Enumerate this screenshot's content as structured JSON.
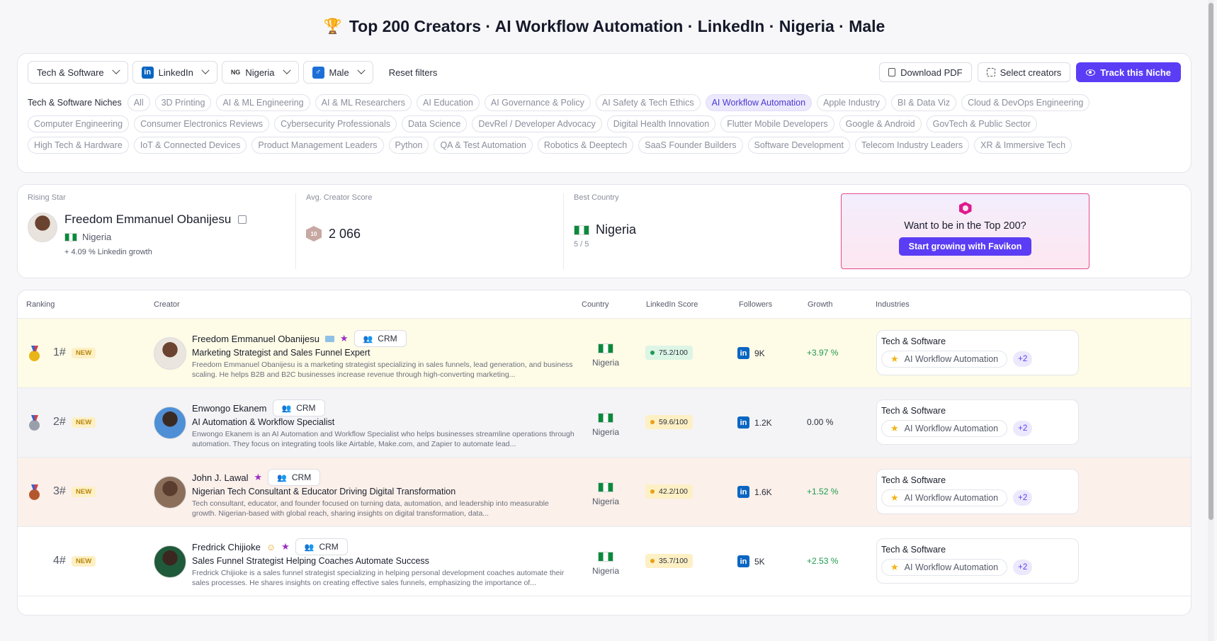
{
  "page_title": "Top 200 Creators · AI Workflow Automation · LinkedIn · Nigeria · Male",
  "filters": {
    "category": "Tech & Software",
    "platform": "LinkedIn",
    "country_code": "NG",
    "country": "Nigeria",
    "gender": "Male",
    "reset_label": "Reset filters",
    "download_label": "Download PDF",
    "select_label": "Select creators",
    "track_label": "Track this Niche",
    "niches_label": "Tech & Software Niches",
    "niche_rows": [
      [
        "All",
        "3D Printing",
        "AI & ML Engineering",
        "AI & ML Researchers",
        "AI Education",
        "AI Governance & Policy",
        "AI Safety & Tech Ethics",
        "AI Workflow Automation",
        "Apple Industry",
        "BI & Data Viz",
        "Cloud & DevOps Engineering"
      ],
      [
        "Computer Engineering",
        "Consumer Electronics Reviews",
        "Cybersecurity Professionals",
        "Data Science",
        "DevRel / Developer Advocacy",
        "Digital Health Innovation",
        "Flutter Mobile Developers",
        "Google & Android",
        "GovTech & Public Sector"
      ],
      [
        "High Tech & Hardware",
        "IoT & Connected Devices",
        "Product Management Leaders",
        "Python",
        "QA & Test Automation",
        "Robotics & Deeptech",
        "SaaS Founder Builders",
        "Software Development",
        "Telecom Industry Leaders",
        "XR & Immersive Tech"
      ]
    ],
    "active_niche": "AI Workflow Automation"
  },
  "stats": {
    "rising_star_label": "Rising Star",
    "rising_star_name": "Freedom Emmanuel Obanijesu",
    "rising_star_country": "Nigeria",
    "rising_star_growth": "+ 4.09 % Linkedin growth",
    "avg_label": "Avg. Creator Score",
    "avg_badge": "10",
    "avg_value": "2 066",
    "best_country_label": "Best Country",
    "best_country": "Nigeria",
    "best_country_sub": "5 / 5",
    "promo_text": "Want to be in the Top 200?",
    "promo_button": "Start growing with Favikon"
  },
  "table": {
    "headers": {
      "ranking": "Ranking",
      "creator": "Creator",
      "country": "Country",
      "score": "LinkedIn Score",
      "followers": "Followers",
      "growth": "Growth",
      "industries": "Industries"
    },
    "crm_label": "CRM",
    "new_label": "NEW",
    "li_letters": "in",
    "rows": [
      {
        "rank": "1#",
        "name": "Freedom Emmanuel Obanijesu",
        "title": "Marketing Strategist and Sales Funnel Expert",
        "desc": "Freedom Emmanuel Obanijesu is a marketing strategist specializing in sales funnels, lead generation, and business scaling. He helps B2B and B2C businesses increase revenue through high-converting marketing...",
        "country": "Nigeria",
        "score": "75.2/100",
        "score_color": "#1e9b50",
        "score_bg": "#dcf5e5",
        "followers": "9K",
        "growth": "+3.97 %",
        "industry": "Tech & Software",
        "tag": "AI Workflow Automation",
        "more": "+2"
      },
      {
        "rank": "2#",
        "name": "Enwongo Ekanem",
        "title": "AI Automation & Workflow Specialist",
        "desc": "Enwongo Ekanem is an AI Automation and Workflow Specialist who helps businesses streamline operations through automation. They focus on integrating tools like Airtable, Make.com, and Zapier to automate lead...",
        "country": "Nigeria",
        "score": "59.6/100",
        "score_color": "#e7a114",
        "score_bg": "#fdf0c4",
        "followers": "1.2K",
        "growth": "0.00 %",
        "industry": "Tech & Software",
        "tag": "AI Workflow Automation",
        "more": "+2"
      },
      {
        "rank": "3#",
        "name": "John J. Lawal",
        "title": "Nigerian Tech Consultant & Educator Driving Digital Transformation",
        "desc": "Tech consultant, educator, and founder focused on turning data, automation, and leadership into measurable growth. Nigerian-based with global reach, sharing insights on digital transformation, data...",
        "country": "Nigeria",
        "score": "42.2/100",
        "score_color": "#e7a114",
        "score_bg": "#fdf0c4",
        "followers": "1.6K",
        "growth": "+1.52 %",
        "industry": "Tech & Software",
        "tag": "AI Workflow Automation",
        "more": "+2"
      },
      {
        "rank": "4#",
        "name": "Fredrick Chijioke",
        "title": "Sales Funnel Strategist Helping Coaches Automate Success",
        "desc": "Fredrick Chijioke is a sales funnel strategist specializing in helping personal development coaches automate their sales processes. He shares insights on creating effective sales funnels, emphasizing the importance of...",
        "country": "Nigeria",
        "score": "35.7/100",
        "score_color": "#e7a114",
        "score_bg": "#fdf0c4",
        "followers": "5K",
        "growth": "+2.53 %",
        "industry": "Tech & Software",
        "tag": "AI Workflow Automation",
        "more": "+2"
      }
    ]
  }
}
